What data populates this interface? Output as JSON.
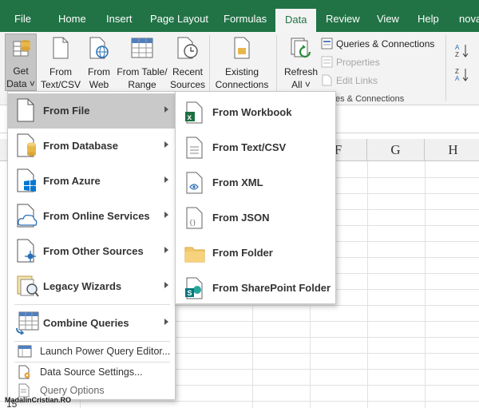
{
  "ribbon_tabs": [
    {
      "label": "File"
    },
    {
      "label": "Home"
    },
    {
      "label": "Insert"
    },
    {
      "label": "Page Layout"
    },
    {
      "label": "Formulas"
    },
    {
      "label": "Data",
      "active": true
    },
    {
      "label": "Review"
    },
    {
      "label": "View"
    },
    {
      "label": "Help"
    },
    {
      "label": "nova"
    }
  ],
  "ribbon": {
    "get_data": {
      "line1": "Get",
      "line2": "Data ˅"
    },
    "from_text_csv": {
      "line1": "From",
      "line2": "Text/CSV"
    },
    "from_web": {
      "line1": "From",
      "line2": "Web"
    },
    "from_table_range": {
      "line1": "From Table/",
      "line2": "Range"
    },
    "recent_sources": {
      "line1": "Recent",
      "line2": "Sources"
    },
    "existing_connections": {
      "line1": "Existing",
      "line2": "Connections"
    },
    "refresh_all": {
      "line1": "Refresh",
      "line2": "All ˅"
    },
    "queries_connections": "Queries & Connections",
    "properties": "Properties",
    "edit_links": "Edit Links",
    "group_label": "es & Connections"
  },
  "sheet": {
    "columns": [
      "F",
      "G",
      "H"
    ],
    "visible_row": "15"
  },
  "get_data_menu": {
    "items": [
      {
        "label": "From File",
        "icon": "file-icon",
        "highlighted": true
      },
      {
        "label": "From Database",
        "icon": "database-icon"
      },
      {
        "label": "From Azure",
        "icon": "azure-icon"
      },
      {
        "label": "From Online Services",
        "icon": "cloud-icon"
      },
      {
        "label": "From Other Sources",
        "icon": "other-sources-icon"
      },
      {
        "label": "Legacy Wizards",
        "icon": "legacy-wizards-icon"
      },
      {
        "label": "Combine Queries",
        "icon": "combine-queries-icon"
      }
    ],
    "actions": [
      {
        "label": "Launch Power Query Editor...",
        "icon": "power-query-editor-icon"
      },
      {
        "label": "Data Source Settings...",
        "icon": "data-source-settings-icon"
      },
      {
        "label": "Query Options",
        "icon": "query-options-icon"
      }
    ]
  },
  "from_file_submenu": {
    "items": [
      {
        "label": "From Workbook",
        "icon": "excel-workbook-icon"
      },
      {
        "label": "From Text/CSV",
        "icon": "text-file-icon"
      },
      {
        "label": "From XML",
        "icon": "xml-file-icon"
      },
      {
        "label": "From JSON",
        "icon": "json-file-icon"
      },
      {
        "label": "From Folder",
        "icon": "folder-icon"
      },
      {
        "label": "From SharePoint Folder",
        "icon": "sharepoint-icon"
      }
    ]
  },
  "watermark": "MadalinCristian.RO",
  "colors": {
    "ribbon_green": "#217346",
    "menu_highlight": "#c9c9c9",
    "excel_green": "#1d6f42",
    "azure_blue": "#0078d4",
    "sharepoint_teal": "#03787c",
    "folder_yellow": "#f3c86a"
  }
}
